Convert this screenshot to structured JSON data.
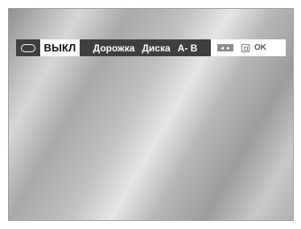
{
  "osd": {
    "repeat_icon": "repeat-icon",
    "status": "ВЫКЛ",
    "modes": [
      "Дорожка",
      "Диска",
      "A- B"
    ],
    "controls": {
      "navigate_icon": "left-right-arrows-icon",
      "enter_icon": "enter-icon",
      "ok_label": "OK"
    }
  }
}
